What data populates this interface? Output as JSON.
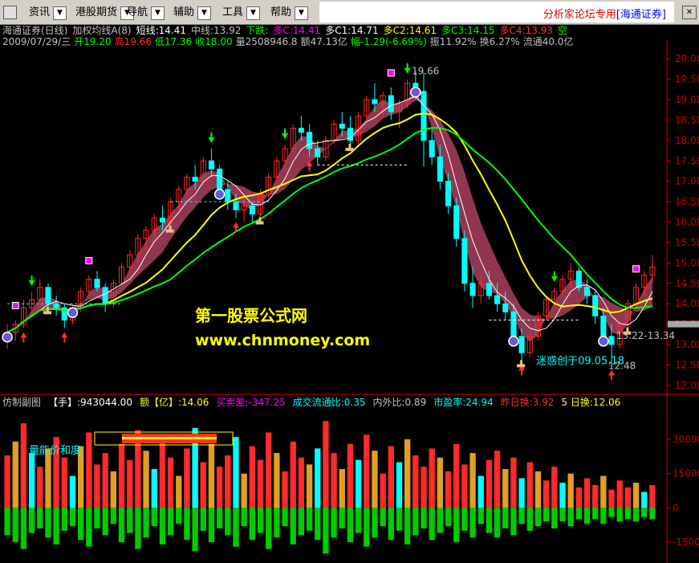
{
  "menu": {
    "items": [
      "资讯",
      "港股期货",
      "导航",
      "辅助",
      "工具",
      "帮助"
    ],
    "arrow_glyph": "▼",
    "close_glyph": "✕"
  },
  "brand": {
    "text": "分析家论坛专用",
    "broker": "[海通证券]"
  },
  "main_header": {
    "line1": [
      {
        "text": "海通证券(日线)",
        "color": "#c0c0c0"
      },
      {
        "text": "加权均线A(8)",
        "color": "#c0c0c0"
      },
      {
        "text": "短线:14.41",
        "color": "#ffffff"
      },
      {
        "text": "中线:13.92",
        "color": "#c0c0c0"
      },
      {
        "text": "下跌:",
        "color": "#00ff00"
      },
      {
        "text": "多C:14.41",
        "color": "#ff00ff"
      },
      {
        "text": "多C1:14.71",
        "color": "#ffffff"
      },
      {
        "text": "多C2:14.61",
        "color": "#ffff00"
      },
      {
        "text": "多C3:14.15",
        "color": "#00ff00"
      },
      {
        "text": "多C4:13.93",
        "color": "#ff3030"
      },
      {
        "text": "空",
        "color": "#00ff00"
      }
    ],
    "line2": [
      {
        "text": "2009/07/29/三",
        "color": "#c0c0c0"
      },
      {
        "text": "开19.20",
        "color": "#00ff00"
      },
      {
        "text": "高19.66",
        "color": "#ff3030"
      },
      {
        "text": "低17.36",
        "color": "#00ff00"
      },
      {
        "text": "收18.00",
        "color": "#00ff00"
      },
      {
        "text": "量2508946.8",
        "color": "#c0c0c0"
      },
      {
        "text": "额47.13亿",
        "color": "#c0c0c0"
      },
      {
        "text": "幅-1.29(-6.69%)",
        "color": "#00ff00"
      },
      {
        "text": "振11.92%",
        "color": "#c0c0c0"
      },
      {
        "text": "换6.27%",
        "color": "#c0c0c0"
      },
      {
        "text": "流通40.0亿",
        "color": "#c0c0c0"
      }
    ]
  },
  "sub_header": [
    {
      "text": "仿制副图",
      "color": "#c0c0c0"
    },
    {
      "text": "【手】:943044.00",
      "color": "#ffffff"
    },
    {
      "text": "额【亿】:14.06",
      "color": "#ffff00"
    },
    {
      "text": "买卖差:-347.25",
      "color": "#ff00ff"
    },
    {
      "text": "成交流通比:0.35",
      "color": "#00ffff"
    },
    {
      "text": "内外比:0.89",
      "color": "#c0c0c0"
    },
    {
      "text": "市盈率:24.94",
      "color": "#00ffff"
    },
    {
      "text": "昨日换:3.92",
      "color": "#ff3030"
    },
    {
      "text": "5 日换:12.06",
      "color": "#ffff00"
    }
  ],
  "annotations": [
    {
      "text": "19.66",
      "color": "#c0c0c0"
    },
    {
      "text": "13.22-13.34",
      "color": "#c0c0c0"
    },
    {
      "text": "12.48",
      "color": "#c0c0c0"
    },
    {
      "text": "迷惑创于09.05.18",
      "color": "#00ffff"
    },
    {
      "text": "量能价和度",
      "color": "#00ffff"
    }
  ],
  "watermark": {
    "title": "第一股票公式网",
    "url": "www.chnmoney.com"
  },
  "colors": {
    "up": "#ff2a2a",
    "down": "#00ffff",
    "ma_short": "#ffffff",
    "ma_mid": "#ffff00",
    "ma_long": "#00ff00",
    "band": "#c04a6a",
    "axis": "#cc0000",
    "vol_down": "#00cc00",
    "vol_gold": "#e0a020"
  },
  "chart_data": [
    {
      "type": "candlestick",
      "title": "海通证券(日线)",
      "ylim": [
        11.8,
        20.3
      ],
      "yticks": [
        12.0,
        12.5,
        13.0,
        13.5,
        14.0,
        14.5,
        15.0,
        15.5,
        16.0,
        16.5,
        17.0,
        17.5,
        18.0,
        18.5,
        19.0,
        19.5,
        20.0
      ],
      "grid": false,
      "ohlc": [
        [
          13.1,
          13.5,
          12.9,
          13.3
        ],
        [
          13.3,
          13.6,
          13.1,
          13.5
        ],
        [
          13.5,
          14.1,
          13.4,
          13.9
        ],
        [
          13.9,
          14.3,
          13.7,
          14.1
        ],
        [
          14.1,
          14.6,
          13.9,
          14.4
        ],
        [
          14.4,
          14.5,
          13.9,
          14.0
        ],
        [
          14.0,
          14.2,
          13.7,
          13.9
        ],
        [
          13.9,
          14.0,
          13.4,
          13.6
        ],
        [
          13.6,
          14.0,
          13.5,
          13.9
        ],
        [
          13.9,
          14.4,
          13.8,
          14.3
        ],
        [
          14.3,
          14.7,
          14.2,
          14.6
        ],
        [
          14.6,
          14.8,
          14.3,
          14.4
        ],
        [
          14.4,
          14.5,
          13.8,
          14.0
        ],
        [
          14.0,
          14.6,
          13.9,
          14.5
        ],
        [
          14.5,
          15.0,
          14.4,
          14.9
        ],
        [
          14.9,
          15.3,
          14.7,
          15.2
        ],
        [
          15.2,
          15.7,
          15.0,
          15.6
        ],
        [
          15.6,
          15.9,
          15.3,
          15.8
        ],
        [
          15.8,
          16.2,
          15.6,
          16.1
        ],
        [
          16.1,
          16.4,
          15.8,
          16.0
        ],
        [
          16.0,
          16.6,
          15.9,
          16.5
        ],
        [
          16.5,
          16.9,
          16.3,
          16.8
        ],
        [
          16.8,
          17.2,
          16.6,
          17.1
        ],
        [
          17.1,
          17.4,
          16.8,
          17.0
        ],
        [
          17.0,
          17.6,
          16.9,
          17.5
        ],
        [
          17.5,
          17.8,
          17.1,
          17.3
        ],
        [
          17.3,
          17.4,
          16.6,
          16.8
        ],
        [
          16.8,
          17.0,
          16.3,
          16.5
        ],
        [
          16.5,
          16.7,
          16.1,
          16.3
        ],
        [
          16.3,
          16.6,
          16.0,
          16.4
        ],
        [
          16.4,
          16.5,
          16.0,
          16.2
        ],
        [
          16.2,
          16.8,
          16.1,
          16.7
        ],
        [
          16.7,
          17.2,
          16.6,
          17.1
        ],
        [
          17.1,
          17.6,
          17.0,
          17.5
        ],
        [
          17.5,
          17.9,
          17.3,
          17.8
        ],
        [
          17.8,
          18.4,
          17.7,
          18.3
        ],
        [
          18.3,
          18.6,
          18.0,
          18.2
        ],
        [
          18.2,
          18.4,
          17.6,
          17.8
        ],
        [
          17.8,
          18.0,
          17.4,
          17.6
        ],
        [
          17.6,
          18.1,
          17.5,
          18.0
        ],
        [
          18.0,
          18.5,
          17.9,
          18.4
        ],
        [
          18.4,
          18.7,
          18.1,
          18.3
        ],
        [
          18.3,
          18.6,
          17.9,
          18.0
        ],
        [
          18.0,
          18.7,
          17.9,
          18.6
        ],
        [
          18.6,
          19.1,
          18.5,
          19.0
        ],
        [
          19.0,
          19.4,
          18.7,
          18.9
        ],
        [
          18.9,
          19.2,
          18.6,
          19.1
        ],
        [
          19.1,
          19.3,
          18.5,
          18.7
        ],
        [
          18.7,
          19.0,
          18.3,
          18.9
        ],
        [
          18.9,
          19.5,
          18.8,
          19.4
        ],
        [
          19.4,
          19.7,
          19.0,
          19.3
        ],
        [
          19.2,
          19.66,
          17.36,
          18.0
        ],
        [
          18.0,
          18.3,
          17.4,
          17.6
        ],
        [
          17.6,
          17.9,
          16.8,
          17.0
        ],
        [
          17.0,
          17.2,
          16.2,
          16.4
        ],
        [
          16.4,
          16.6,
          15.4,
          15.6
        ],
        [
          15.6,
          15.8,
          14.3,
          14.5
        ],
        [
          14.5,
          14.9,
          13.9,
          14.2
        ],
        [
          14.2,
          14.7,
          14.0,
          14.5
        ],
        [
          14.5,
          14.8,
          14.1,
          14.2
        ],
        [
          14.2,
          14.5,
          13.8,
          14.0
        ],
        [
          14.0,
          14.3,
          13.6,
          13.8
        ],
        [
          13.8,
          14.0,
          13.0,
          13.2
        ],
        [
          13.2,
          13.4,
          12.6,
          12.8
        ],
        [
          12.8,
          13.3,
          12.7,
          13.2
        ],
        [
          13.2,
          13.8,
          13.1,
          13.7
        ],
        [
          13.7,
          14.2,
          13.6,
          14.1
        ],
        [
          14.1,
          14.4,
          13.9,
          14.3
        ],
        [
          14.3,
          14.7,
          14.2,
          14.6
        ],
        [
          14.6,
          15.0,
          14.4,
          14.8
        ],
        [
          14.8,
          14.9,
          14.3,
          14.4
        ],
        [
          14.4,
          14.6,
          14.0,
          14.2
        ],
        [
          14.2,
          14.3,
          13.5,
          13.7
        ],
        [
          13.7,
          13.9,
          13.0,
          13.2
        ],
        [
          13.2,
          13.5,
          12.48,
          13.0
        ],
        [
          13.0,
          13.6,
          12.9,
          13.5
        ],
        [
          13.5,
          14.1,
          13.4,
          14.0
        ],
        [
          14.0,
          14.5,
          13.9,
          14.4
        ],
        [
          14.4,
          14.8,
          14.2,
          14.7
        ],
        [
          14.7,
          15.2,
          14.5,
          14.9
        ]
      ],
      "series": [
        {
          "name": "短线"
        },
        {
          "name": "中线"
        },
        {
          "name": "下跌"
        }
      ]
    },
    {
      "type": "bar",
      "title": "仿制副图",
      "ylim": [
        -22000,
        43000
      ],
      "yticks": [
        30000,
        15000,
        0,
        -15000
      ],
      "up_values": [
        23000,
        29000,
        37000,
        24000,
        18000,
        26000,
        31000,
        22000,
        14000,
        27000,
        33000,
        19000,
        24000,
        16000,
        28000,
        21000,
        34000,
        25000,
        17000,
        30000,
        22000,
        14000,
        26000,
        35000,
        20000,
        28000,
        18000,
        23000,
        31000,
        15000,
        27000,
        21000,
        33000,
        24000,
        16000,
        29000,
        22000,
        19000,
        26000,
        38000,
        24000,
        17000,
        28000,
        21000,
        32000,
        25000,
        15000,
        27000,
        20000,
        30000,
        23000,
        18000,
        26000,
        22000,
        16000,
        28000,
        19000,
        24000,
        14000,
        21000,
        25000,
        17000,
        22000,
        13000,
        20000,
        16000,
        12000,
        18000,
        11000,
        15000,
        9000,
        13000,
        10000,
        14000,
        8000,
        12000,
        9000,
        11000,
        7000,
        10000
      ],
      "down_values": [
        -12000,
        -15000,
        -18000,
        -11000,
        -9000,
        -13000,
        -16000,
        -10000,
        -8000,
        -14000,
        -17000,
        -9000,
        -12000,
        -7000,
        -15000,
        -11000,
        -18000,
        -13000,
        -8000,
        -16000,
        -12000,
        -7000,
        -14000,
        -19000,
        -10000,
        -15000,
        -9000,
        -12000,
        -17000,
        -8000,
        -14000,
        -11000,
        -18000,
        -13000,
        -8000,
        -16000,
        -12000,
        -10000,
        -14000,
        -20000,
        -13000,
        -9000,
        -15000,
        -11000,
        -17000,
        -13000,
        -8000,
        -14000,
        -10000,
        -16000,
        -12000,
        -9000,
        -14000,
        -11000,
        -8000,
        -15000,
        -10000,
        -13000,
        -7000,
        -11000,
        -13000,
        -9000,
        -12000,
        -7000,
        -10000,
        -8000,
        -6000,
        -9000,
        -6000,
        -8000,
        -5000,
        -7000,
        -5000,
        -7000,
        -4000,
        -6000,
        -5000,
        -6000,
        -4000,
        -5000
      ]
    }
  ]
}
